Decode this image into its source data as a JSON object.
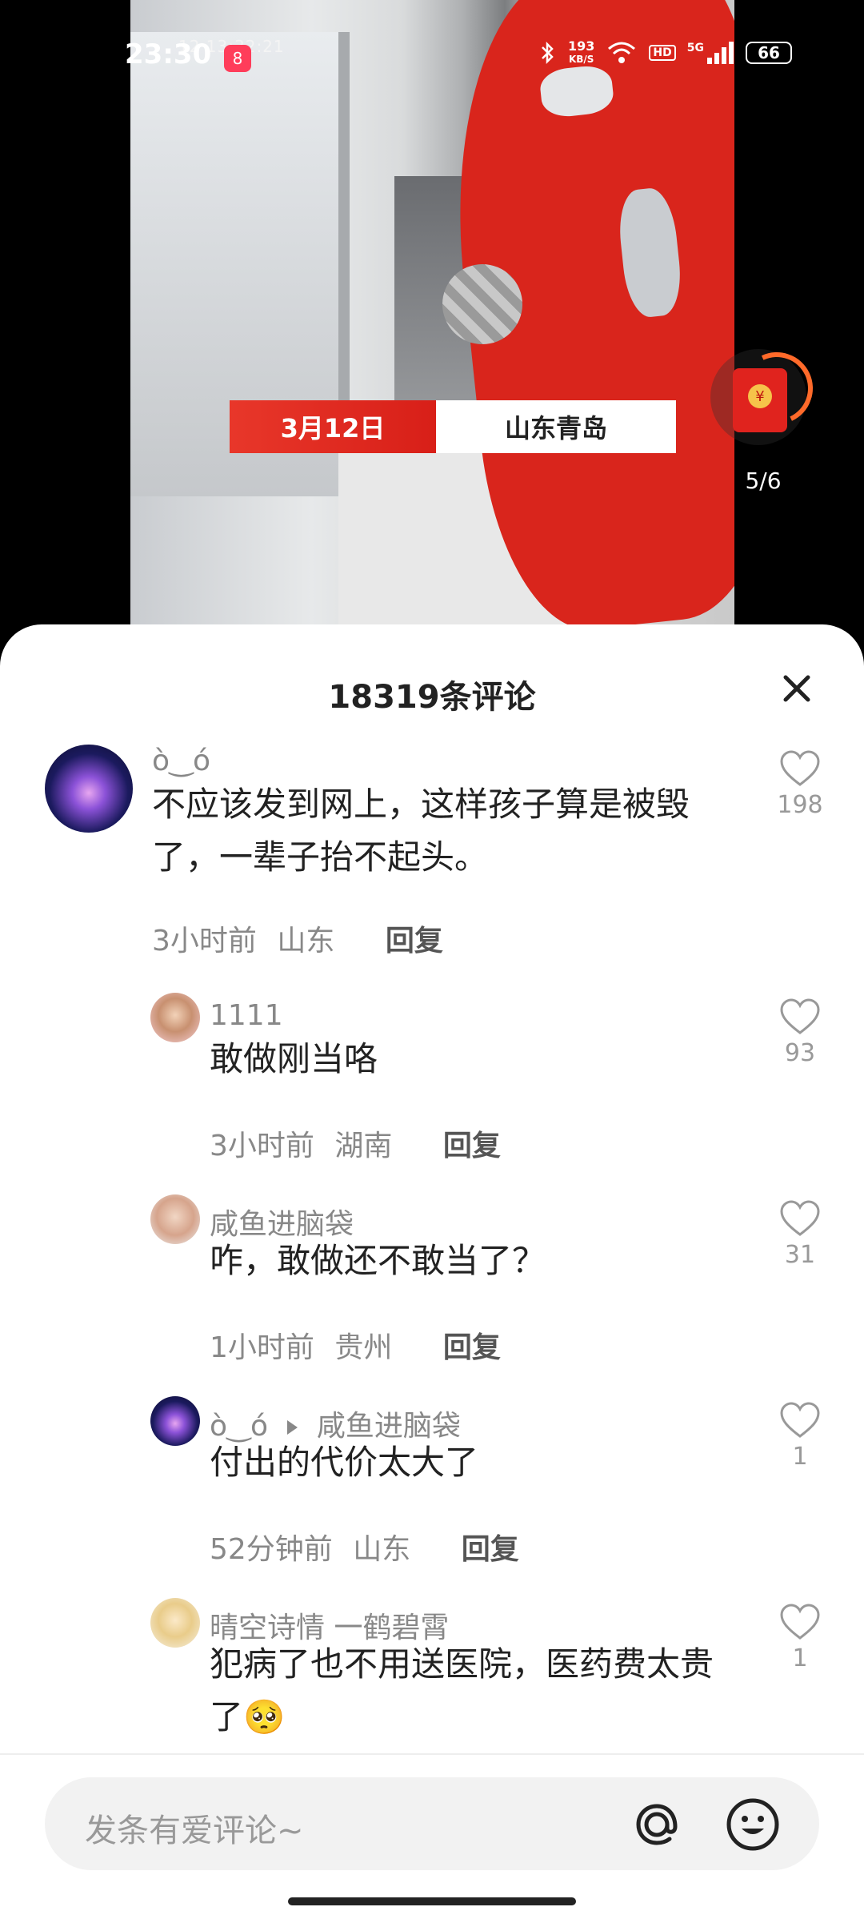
{
  "status_bar": {
    "time": "23:30",
    "app_badge": "8",
    "speed_value": "193",
    "speed_unit": "KB/S",
    "hd": "HD",
    "network": "5G",
    "battery": "66"
  },
  "video": {
    "cctv_timestamp": "12  13:32:21",
    "date_label": "3月12日",
    "place_label": "山东青岛",
    "redpacket_progress": "5/6"
  },
  "comments_panel": {
    "title": "18319条评论",
    "reply_label": "回复",
    "input_placeholder": "发条有爱评论~",
    "comments": [
      {
        "user": "ò‿ó",
        "text": "不应该发到网上，这样孩子算是被毁了，一辈子抬不起头。",
        "time": "3小时前",
        "location": "山东",
        "likes": "198"
      },
      {
        "user": "1111",
        "text": "敢做刚当咯",
        "time": "3小时前",
        "location": "湖南",
        "likes": "93"
      },
      {
        "user": "咸鱼进脑袋",
        "text": "咋，敢做还不敢当了？",
        "time": "1小时前",
        "location": "贵州",
        "likes": "31"
      },
      {
        "user": "ò‿ó",
        "reply_to": "咸鱼进脑袋",
        "text": "付出的代价太大了",
        "time": "52分钟前",
        "location": "山东",
        "likes": "1"
      },
      {
        "user": "晴空诗情 一鹤碧霄",
        "text": "犯病了也不用送医院，医药费太贵了🥺",
        "likes": "1"
      }
    ]
  },
  "colors": {
    "accent_red": "#e0231e",
    "text_main": "#222222",
    "text_meta": "#888888"
  },
  "icons": [
    "close-icon",
    "heart-icon",
    "at-icon",
    "emoji-icon",
    "red-packet-icon",
    "wifi-icon",
    "bluetooth-icon",
    "signal-icon",
    "battery-icon"
  ]
}
